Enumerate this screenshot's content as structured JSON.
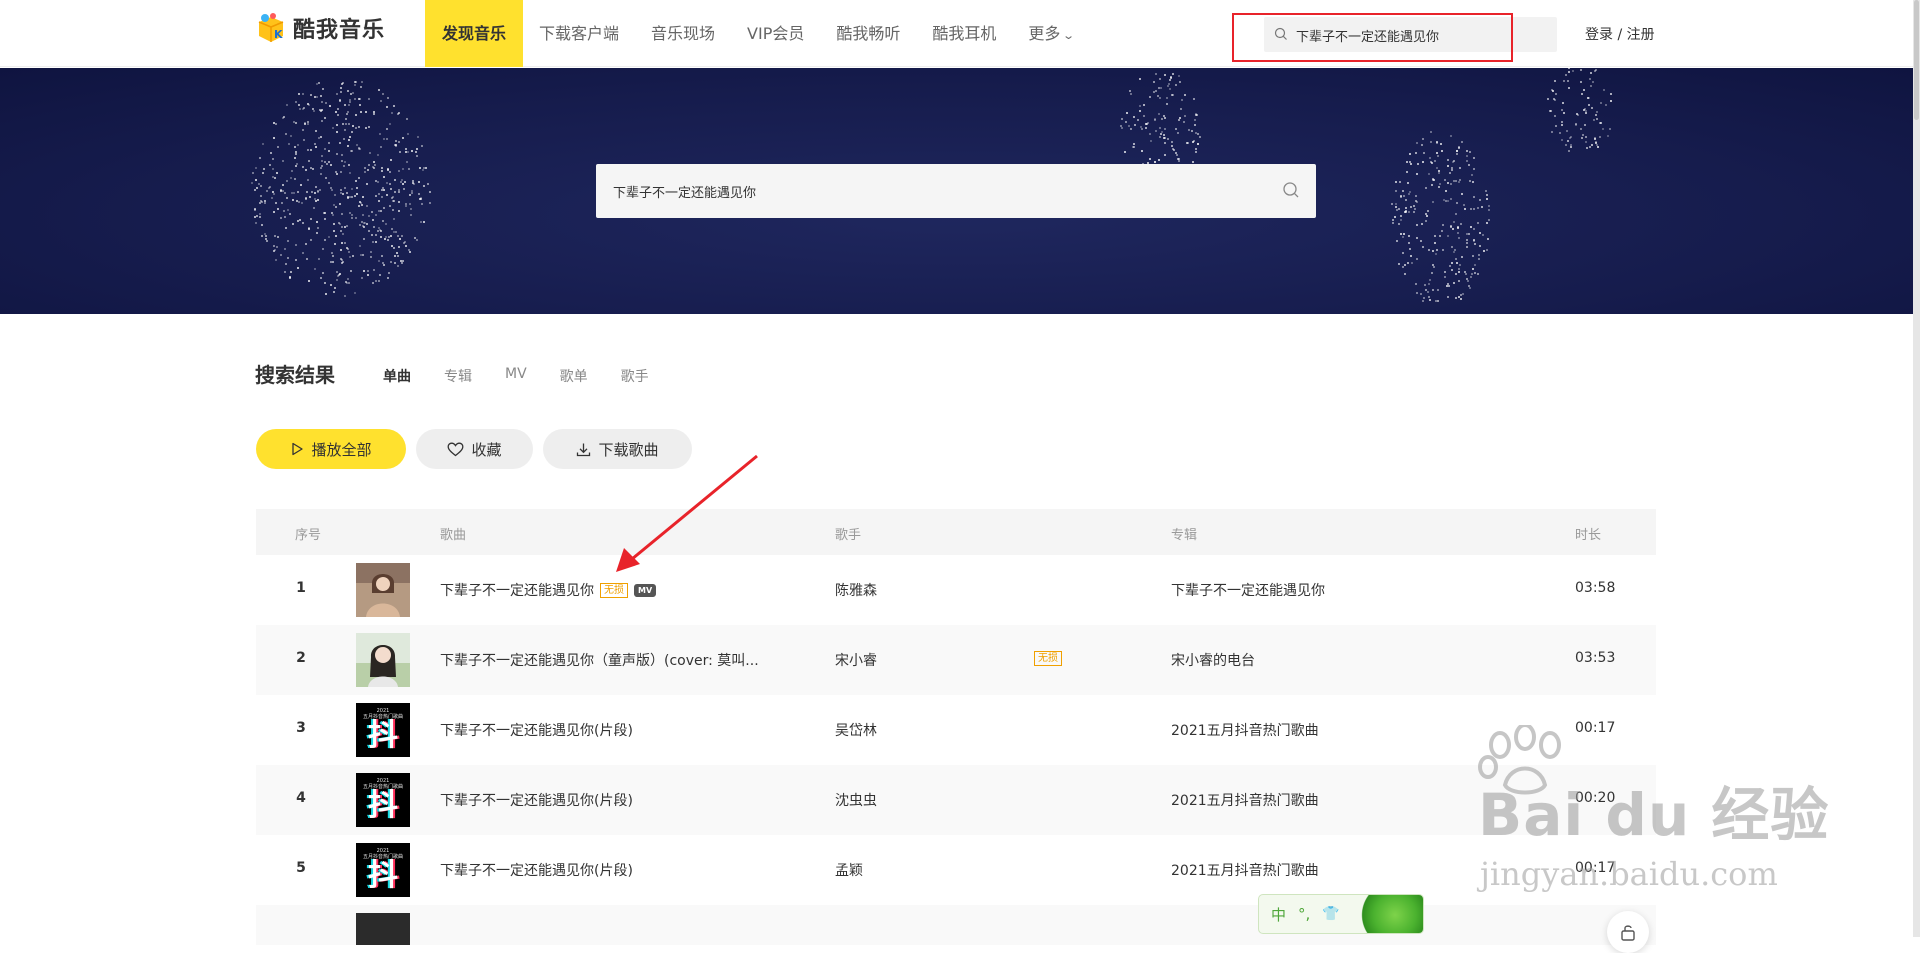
{
  "brand": {
    "name": "酷我音乐",
    "accent": "#ffe12e"
  },
  "nav": [
    {
      "label": "发现音乐",
      "active": true
    },
    {
      "label": "下载客户端"
    },
    {
      "label": "音乐现场"
    },
    {
      "label": "VIP会员"
    },
    {
      "label": "酷我畅听"
    },
    {
      "label": "酷我耳机"
    },
    {
      "label": "更多"
    }
  ],
  "header": {
    "search_value": "下辈子不一定还能遇见你",
    "login": "登录 / 注册"
  },
  "banner": {
    "search_value": "下辈子不一定还能遇见你"
  },
  "results": {
    "title": "搜索结果",
    "tabs": [
      {
        "label": "单曲",
        "active": true
      },
      {
        "label": "专辑"
      },
      {
        "label": "MV"
      },
      {
        "label": "歌单"
      },
      {
        "label": "歌手"
      }
    ]
  },
  "actions": {
    "play_all": "播放全部",
    "favorite": "收藏",
    "download": "下载歌曲"
  },
  "table": {
    "headers": {
      "index": "序号",
      "song": "歌曲",
      "artist": "歌手",
      "album": "专辑",
      "duration": "时长"
    },
    "rows": [
      {
        "index": "1",
        "song": "下辈子不一定还能遇见你",
        "tag": "无损",
        "mv": "MV",
        "artist": "陈雅森",
        "album": "下辈子不一定还能遇见你",
        "duration": "03:58",
        "cover": "portrait-warm"
      },
      {
        "index": "2",
        "song": "下辈子不一定还能遇见你（童声版）(cover: 莫叫...",
        "tag": "无损",
        "artist": "宋小睿",
        "album": "宋小睿的电台",
        "duration": "03:53",
        "cover": "portrait-green"
      },
      {
        "index": "3",
        "song": "下辈子不一定还能遇见你(片段)",
        "artist": "吴岱林",
        "album": "2021五月抖音热门歌曲",
        "duration": "00:17",
        "cover": "tiktok"
      },
      {
        "index": "4",
        "song": "下辈子不一定还能遇见你(片段)",
        "artist": "沈虫虫",
        "album": "2021五月抖音热门歌曲",
        "duration": "00:20",
        "cover": "tiktok"
      },
      {
        "index": "5",
        "song": "下辈子不一定还能遇见你(片段)",
        "artist": "孟颖",
        "album": "2021五月抖音热门歌曲",
        "duration": "00:17",
        "cover": "tiktok"
      }
    ],
    "tiktok_cover": {
      "line1": "2021",
      "line2": "五月抖音热门歌曲",
      "glyph": "抖"
    }
  },
  "watermark": {
    "text": "Bai du 经验",
    "url": "jingyan.baidu.com"
  },
  "ime": {
    "lang": "中",
    "punct": "°,"
  },
  "colors": {
    "annotation_red": "#e8232a",
    "banner_bg": "#161c4d",
    "tag_orange": "#f0a000"
  }
}
